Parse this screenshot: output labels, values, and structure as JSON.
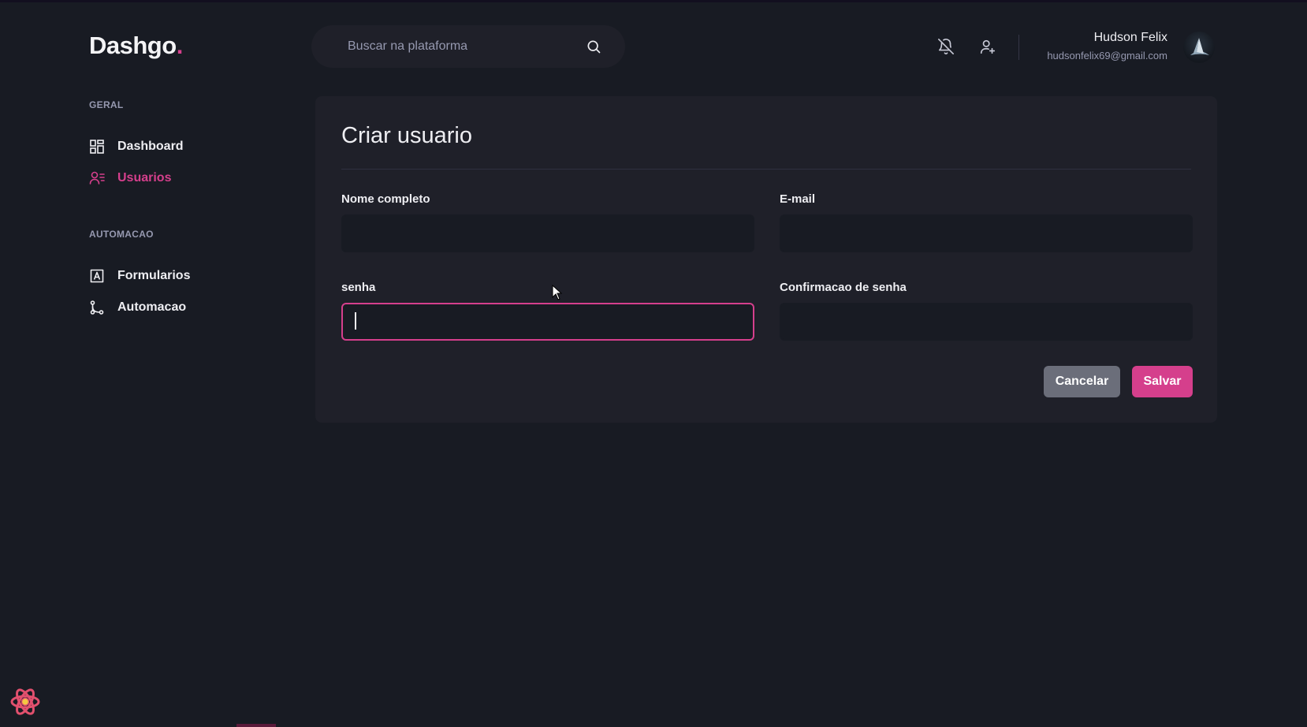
{
  "app": {
    "logo_text": "Dashgo",
    "logo_dot": "."
  },
  "header": {
    "search_placeholder": "Buscar na plataforma",
    "profile": {
      "name": "Hudson Felix",
      "email": "hudsonfelix69@gmail.com"
    },
    "icons": [
      "search-icon",
      "bell-off-icon",
      "user-add-icon"
    ]
  },
  "sidebar": {
    "sections": [
      {
        "title": "GERAL",
        "items": [
          {
            "label": "Dashboard",
            "icon": "dashboard-grid-icon",
            "active": false
          },
          {
            "label": "Usuarios",
            "icon": "users-icon",
            "active": true
          }
        ]
      },
      {
        "title": "AUTOMACAO",
        "items": [
          {
            "label": "Formularios",
            "icon": "form-icon",
            "active": false
          },
          {
            "label": "Automacao",
            "icon": "git-branch-icon",
            "active": false
          }
        ]
      }
    ]
  },
  "form": {
    "title": "Criar usuario",
    "fields": [
      {
        "label": "Nome completo",
        "value": ""
      },
      {
        "label": "E-mail",
        "value": ""
      },
      {
        "label": "senha",
        "value": "",
        "focused": true
      },
      {
        "label": "Confirmacao de senha",
        "value": ""
      }
    ],
    "cancel_label": "Cancelar",
    "save_label": "Salvar"
  },
  "colors": {
    "background": "#181b23",
    "card": "#1f2029",
    "accent": "#d53f8c",
    "muted": "#9699b0",
    "cancel_button": "#6b6e7a"
  }
}
